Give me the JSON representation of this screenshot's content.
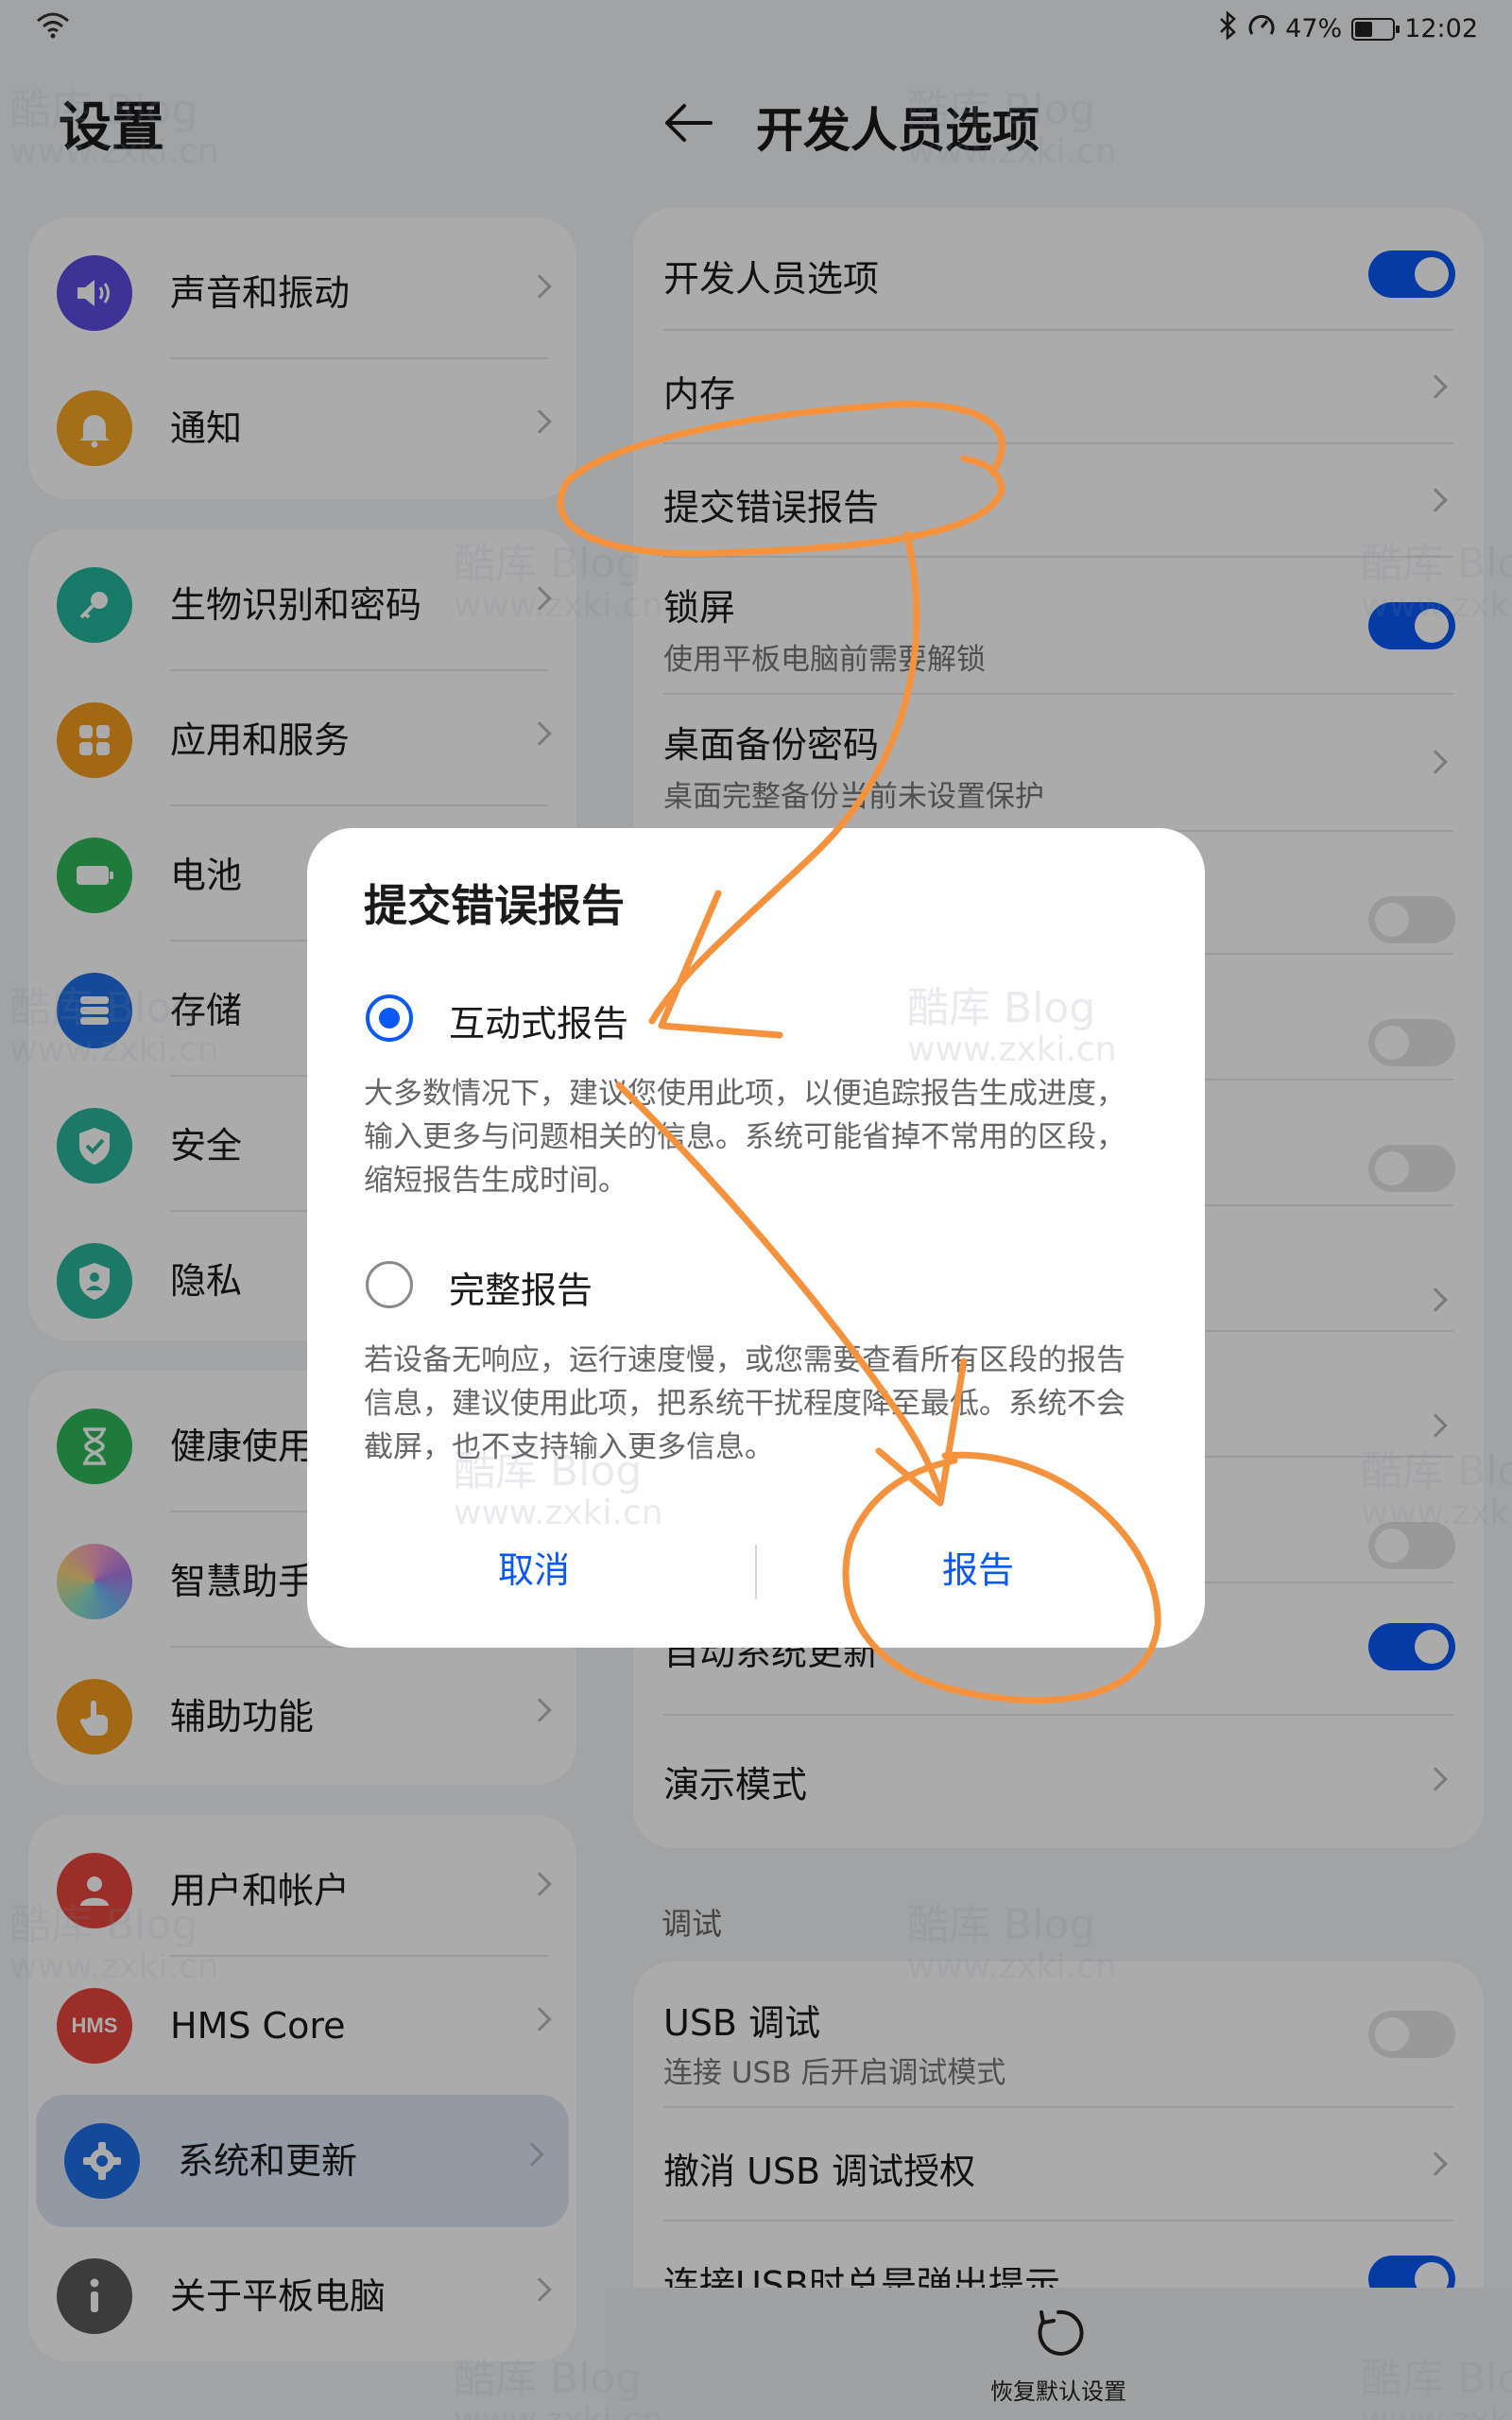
{
  "status_bar": {
    "battery": "47%",
    "time": "12:02",
    "battery_fraction": 0.47
  },
  "left": {
    "title": "设置",
    "groups": [
      [
        {
          "label": "声音和振动",
          "icon": "speaker-icon",
          "color": "#5b4be0"
        },
        {
          "label": "通知",
          "icon": "bell-icon",
          "color": "#f5a623"
        }
      ],
      [
        {
          "label": "生物识别和密码",
          "icon": "key-icon",
          "color": "#23b59a"
        },
        {
          "label": "应用和服务",
          "icon": "apps-icon",
          "color": "#f29b1f"
        },
        {
          "label": "电池",
          "icon": "battery-icon",
          "color": "#2db85a"
        },
        {
          "label": "存储",
          "icon": "storage-icon",
          "color": "#1f6fe5"
        },
        {
          "label": "安全",
          "icon": "shield-check-icon",
          "color": "#2ab59b"
        },
        {
          "label": "隐私",
          "icon": "privacy-icon",
          "color": "#2ab59b"
        }
      ],
      [
        {
          "label": "健康使用平板电脑",
          "icon": "hourglass-icon",
          "color": "#2db85a"
        },
        {
          "label": "智慧助手",
          "icon": "assistant-icon",
          "color": "#b07be8"
        },
        {
          "label": "辅助功能",
          "icon": "hand-icon",
          "color": "#f29b1f"
        }
      ],
      [
        {
          "label": "用户和帐户",
          "icon": "user-icon",
          "color": "#e8453c"
        },
        {
          "label": "HMS Core",
          "icon": "hms-icon",
          "color": "#e8453c",
          "badge": "HMS"
        },
        {
          "label": "系统和更新",
          "icon": "gear-icon",
          "color": "#1f6fe5",
          "selected": true
        },
        {
          "label": "关于平板电脑",
          "icon": "info-icon",
          "color": "#5a5a5a"
        }
      ]
    ]
  },
  "right": {
    "title": "开发人员选项",
    "card1": [
      {
        "title": "开发人员选项",
        "control": "toggle",
        "state": "on"
      },
      {
        "title": "内存",
        "control": "chevron"
      },
      {
        "title": "提交错误报告",
        "control": "chevron"
      },
      {
        "title": "锁屏",
        "subtitle": "使用平板电脑前需要解锁",
        "control": "toggle",
        "state": "on"
      },
      {
        "title": "桌面备份密码",
        "subtitle": "桌面完整备份当前未设置保护",
        "control": "chevron"
      }
    ],
    "hidden_toggles": [
      "off",
      "off",
      "off"
    ],
    "auto_update": {
      "title": "自动系统更新",
      "state": "on"
    },
    "demo_mode": {
      "title": "演示模式"
    },
    "section_debug": "调试",
    "usb_debug": {
      "title": "USB 调试",
      "subtitle": "连接 USB 后开启调试模式",
      "state": "off"
    },
    "revoke_usb": {
      "title": "撤消 USB 调试授权"
    },
    "usb_prompt": {
      "title": "连接USB时总是弹出提示",
      "state": "on"
    },
    "reset_label": "恢复默认设置"
  },
  "dialog": {
    "title": "提交错误报告",
    "option1": {
      "label": "互动式报告",
      "selected": true,
      "desc": "大多数情况下，建议您使用此项，以便追踪报告生成进度，输入更多与问题相关的信息。系统可能省掉不常用的区段，缩短报告生成时间。"
    },
    "option2": {
      "label": "完整报告",
      "selected": false,
      "desc": "若设备无响应，运行速度慢，或您需要查看所有区段的报告信息，建议使用此项，把系统干扰程度降至最低。系统不会截屏，也不支持输入更多信息。"
    },
    "cancel": "取消",
    "confirm": "报告"
  },
  "watermark": {
    "text1": "酷库 Blog",
    "text2": "www.zxki.cn"
  },
  "colors": {
    "accent": "#0a59f7",
    "annotation": "#f5923e"
  }
}
